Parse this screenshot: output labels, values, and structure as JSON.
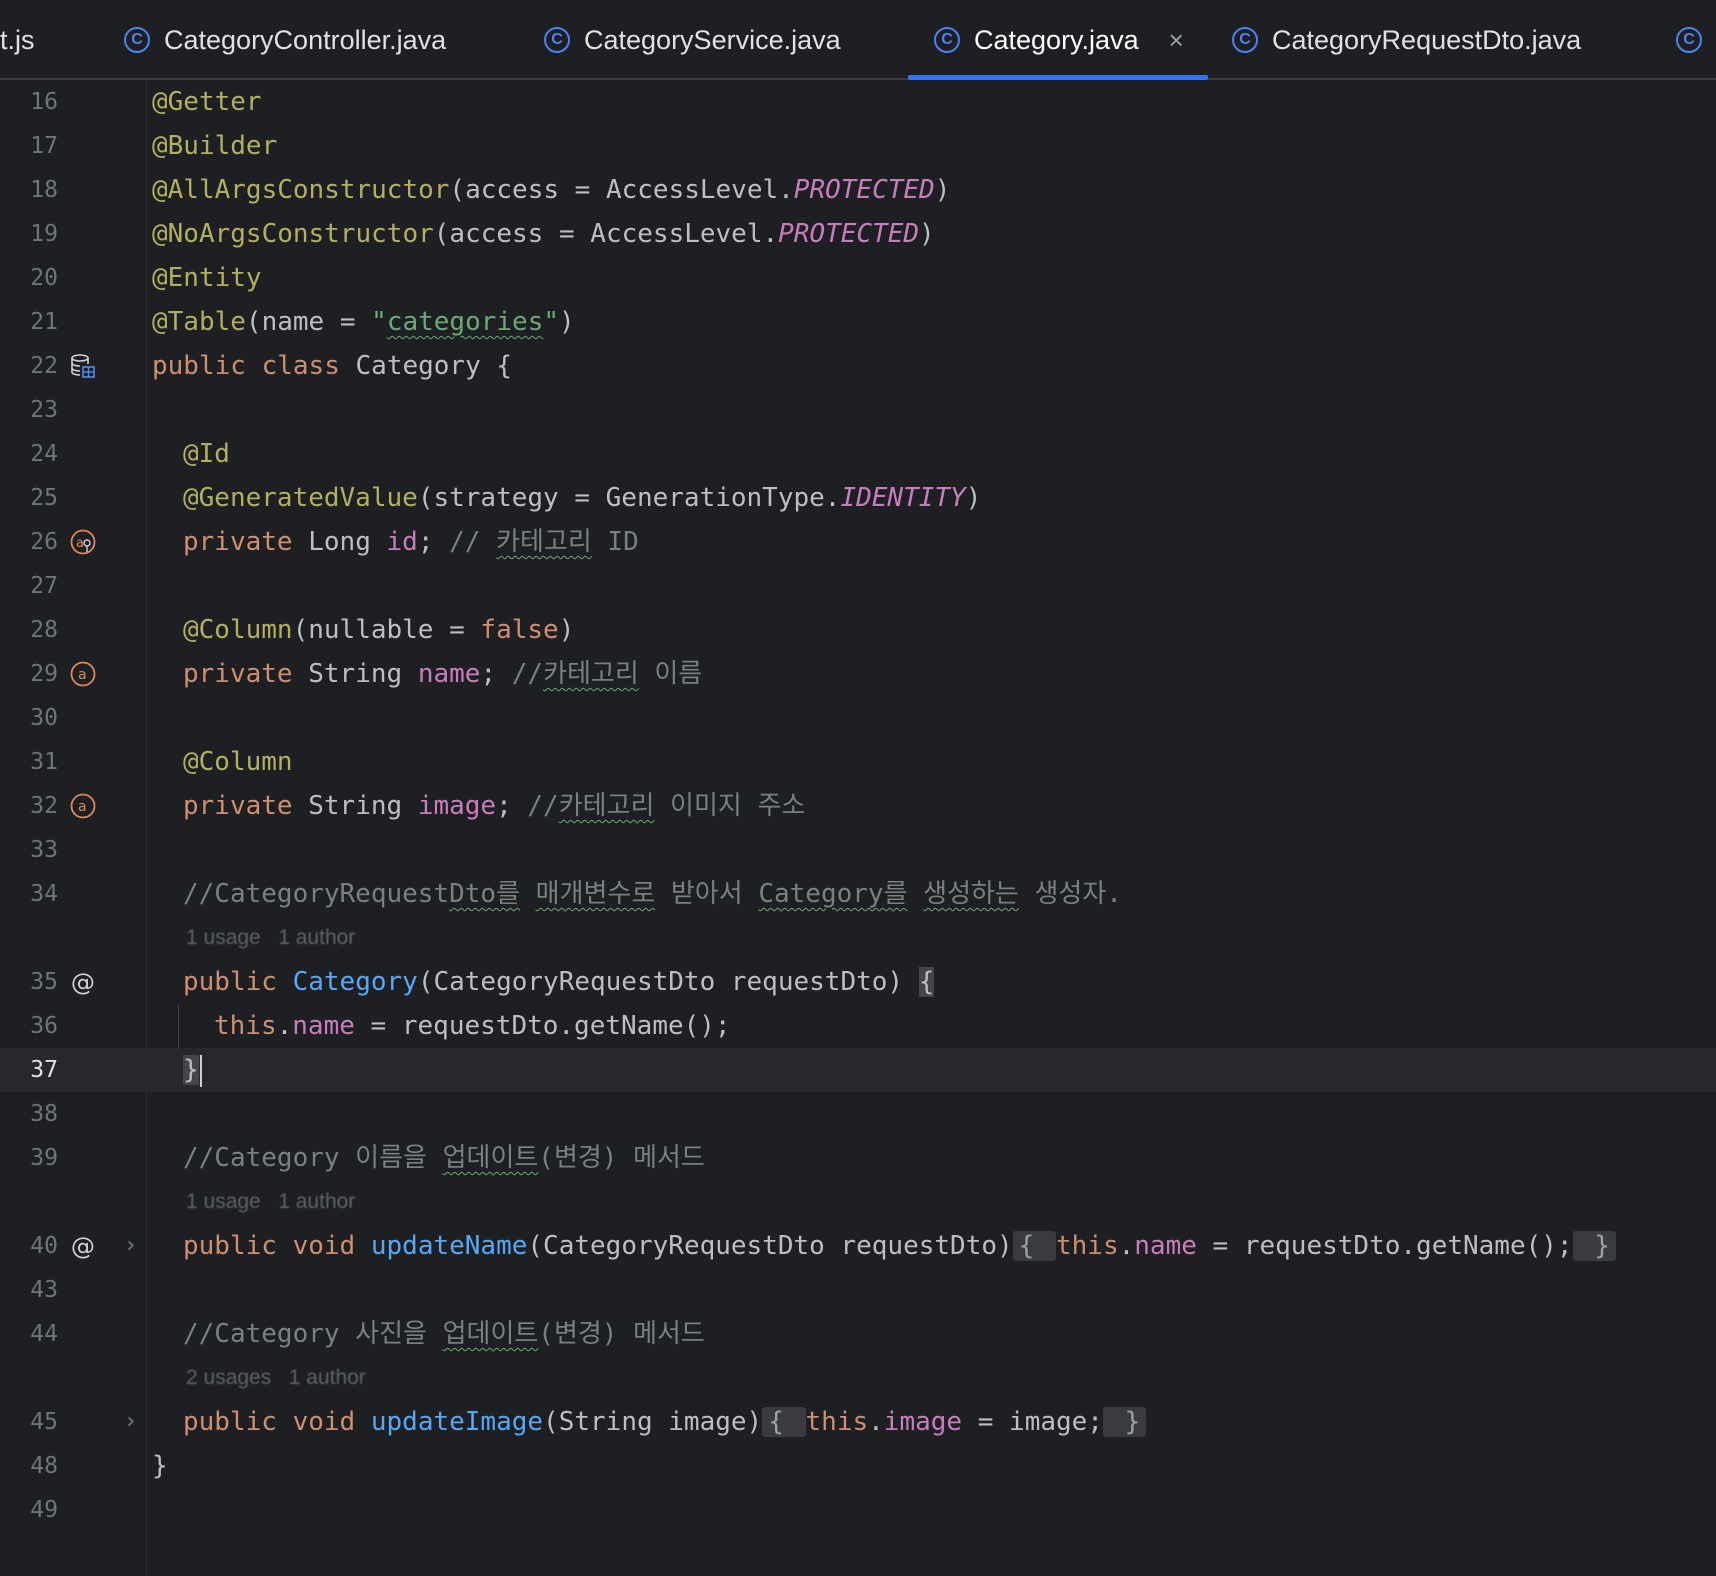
{
  "tabs": [
    {
      "label": "t.js",
      "icon": "none"
    },
    {
      "label": "CategoryController.java",
      "icon": "class-icon"
    },
    {
      "label": "CategoryService.java",
      "icon": "class-icon"
    },
    {
      "label": "Category.java",
      "icon": "class-icon",
      "active": true,
      "close": "×"
    },
    {
      "label": "CategoryRequestDto.java",
      "icon": "class-icon"
    }
  ],
  "overflow_tab_icon": "class-icon",
  "lines": {
    "l16": "16",
    "l17": "17",
    "l18": "18",
    "l19": "19",
    "l20": "20",
    "l21": "21",
    "l22": "22",
    "l23": "23",
    "l24": "24",
    "l25": "25",
    "l26": "26",
    "l27": "27",
    "l28": "28",
    "l29": "29",
    "l30": "30",
    "l31": "31",
    "l32": "32",
    "l33": "33",
    "l34": "34",
    "l35": "35",
    "l36": "36",
    "l37": "37",
    "l38": "38",
    "l39": "39",
    "l40": "40",
    "l43": "43",
    "l44": "44",
    "l45": "45",
    "l48": "48",
    "l49": "49"
  },
  "code": {
    "getter": "@Getter",
    "builder": "@Builder",
    "all_args": "@AllArgsConstructor",
    "access_eq": "(access = AccessLevel.",
    "protected": "PROTECTED",
    "close_paren": ")",
    "no_args": "@NoArgsConstructor",
    "entity": "@Entity",
    "table": "@Table",
    "name_eq": "(name = ",
    "quote": "\"",
    "categories": "categories",
    "public": "public",
    "class": "class",
    "class_decl": " Category {",
    "id_ann": "@Id",
    "gen_value": "@GeneratedValue",
    "strategy": "(strategy = GenerationType.",
    "identity": "IDENTITY",
    "private": "private",
    "long": " Long ",
    "id": "id",
    "semi": "; ",
    "cmt_id_slash": "// ",
    "cmt_id_kr": "카테고리",
    "cmt_id_rest": " ID",
    "column_ann": "@Column",
    "nullable": "(nullable = ",
    "false": "false",
    "string": " String ",
    "name": "name",
    "cmt_name_slash": "//",
    "cmt_name_kr": "카테고리",
    "cmt_name_rest": " 이름",
    "image": "image",
    "cmt_image_slash": "//",
    "cmt_image_kr": "카테고리",
    "cmt_image_rest": " 이미지 주소",
    "cmt34_a": "//CategoryRequest",
    "cmt34_b": "Dto를",
    "cmt34_c": " ",
    "cmt34_d": "매개변수로",
    "cmt34_e": " 받아서 ",
    "cmt34_f": "Category를",
    "cmt34_g": " ",
    "cmt34_h": "생성하는",
    "cmt34_i": " 생성자.",
    "ctor_name": "Category",
    "ctor_params": "(CategoryRequestDto requestDto) ",
    "open_brace": "{",
    "this": "this",
    "dot": ".",
    "assign_get": " = requestDto.getName();",
    "close_brace": "}",
    "cmt39_a": "//Category 이름을 ",
    "cmt39_b": "업데이트",
    "cmt39_c": "(변경) 메서드",
    "void": "void",
    "update_name": "updateName",
    "update_name_params": "(CategoryRequestDto requestDto)",
    "fold_open": "{ ",
    "fold_close": " }",
    "update_name_body_eq": " = requestDto.getName();",
    "cmt44_a": "//Category 사진을 ",
    "cmt44_b": "업데이트",
    "cmt44_c": "(변경) 메서드",
    "update_image": "updateImage",
    "update_image_params": "(String image)",
    "image_assign": " = image;",
    "final_brace": "}"
  },
  "inlay_hints": {
    "h35": "1 usage   1 author",
    "h40": "1 usage   1 author",
    "h45": "2 usages   1 author"
  },
  "colors": {
    "background": "#1e1f22",
    "annotation": "#b3ae60",
    "keyword": "#cf8e6d",
    "field": "#c77dbb",
    "string": "#6aab73",
    "comment": "#7a7e85",
    "function": "#56a8f5",
    "tab_accent": "#3574f0"
  }
}
